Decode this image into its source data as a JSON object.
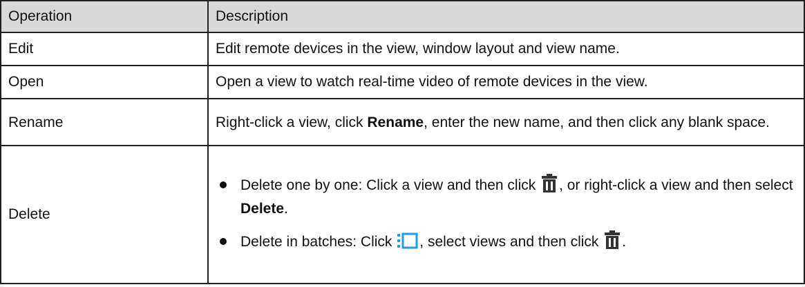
{
  "table": {
    "headers": [
      "Operation",
      "Description"
    ],
    "rows": [
      {
        "operation": "Edit",
        "description": "Edit remote devices in the view, window layout and view name."
      },
      {
        "operation": "Open",
        "description": "Open a view to watch real-time video of remote devices in the view."
      },
      {
        "operation": "Rename",
        "description_parts": [
          "Right-click a view, click ",
          "Rename",
          ", enter the new name, and then click any blank space."
        ]
      },
      {
        "operation": "Delete",
        "bullets": [
          {
            "parts": [
              "Delete one by one: Click a view and then click ",
              ", or right-click a view and then select ",
              "Delete",
              "."
            ]
          },
          {
            "parts": [
              "Delete in batches: Click ",
              ", select views and then click ",
              "."
            ]
          }
        ]
      }
    ]
  },
  "icons": {
    "delete": "trash-icon",
    "batch": "multi-select-icon"
  },
  "colors": {
    "header_bg": "#d9d9d9",
    "border": "#1f1f1f",
    "icon_dark": "#333333",
    "icon_blue": "#1a9cf0"
  }
}
